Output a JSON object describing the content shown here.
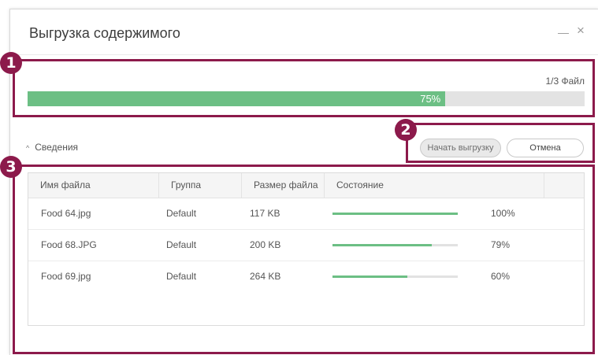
{
  "dialog": {
    "title": "Выгрузка содержимого",
    "minimize_glyph": "—",
    "close_glyph": "×"
  },
  "overall": {
    "count_text": "1/3 Файл",
    "progress_percent": 75,
    "progress_label": "75%"
  },
  "details": {
    "chevron_glyph": "^",
    "label": "Сведения"
  },
  "buttons": {
    "start_label": "Начать выгрузку",
    "cancel_label": "Отмена"
  },
  "table": {
    "columns": [
      "Имя файла",
      "Группа",
      "Размер файла",
      "Состояние",
      ""
    ],
    "rows": [
      {
        "name": "Food 64.jpg",
        "group": "Default",
        "size": "117 KB",
        "progress": 100,
        "progress_label": "100%"
      },
      {
        "name": "Food 68.JPG",
        "group": "Default",
        "size": "200 KB",
        "progress": 79,
        "progress_label": "79%"
      },
      {
        "name": "Food 69.jpg",
        "group": "Default",
        "size": "264 KB",
        "progress": 60,
        "progress_label": "60%"
      }
    ]
  },
  "annotations": {
    "badge_1": "1",
    "badge_2": "2",
    "badge_3": "3",
    "color": "#8c1a4b"
  },
  "colors": {
    "progress_green": "#6cbf84",
    "track_gray": "#e3e3e3"
  }
}
